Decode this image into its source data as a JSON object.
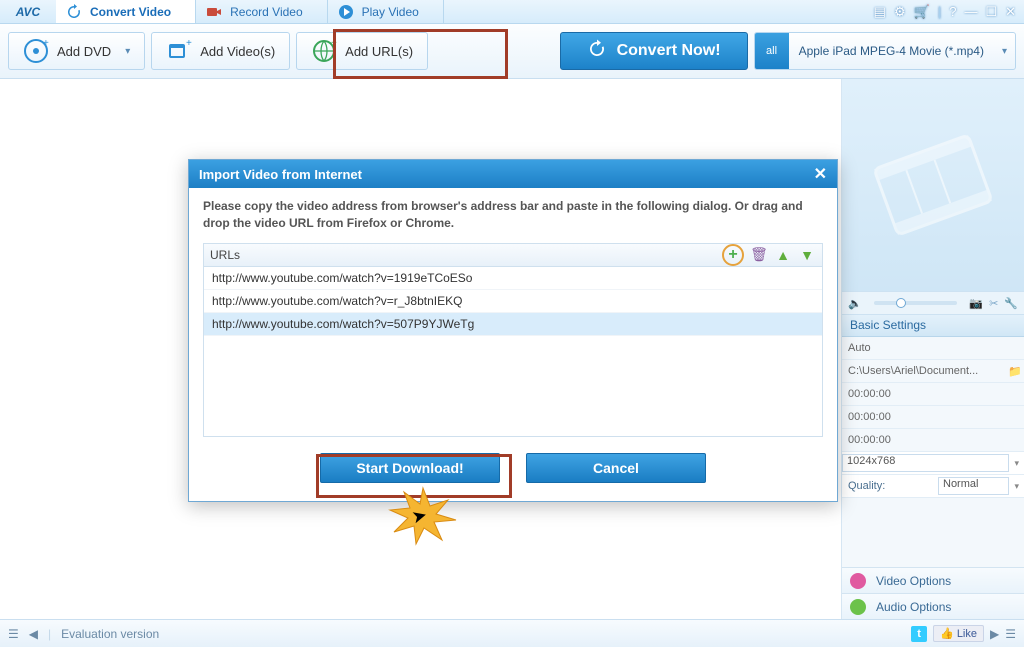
{
  "app": {
    "logo": "AVC"
  },
  "tabs": [
    {
      "label": "Convert Video",
      "active": true
    },
    {
      "label": "Record Video",
      "active": false
    },
    {
      "label": "Play Video",
      "active": false
    }
  ],
  "toolbar": {
    "add_dvd": "Add DVD",
    "add_videos": "Add Video(s)",
    "add_urls": "Add URL(s)",
    "convert_now": "Convert Now!",
    "profile": "Apple iPad MPEG-4 Movie (*.mp4)"
  },
  "dialog": {
    "title": "Import Video from Internet",
    "message": "Please copy the video address from browser's address bar and paste in the following dialog. Or drag and drop the video URL from Firefox or Chrome.",
    "urls_header": "URLs",
    "urls": [
      "http://www.youtube.com/watch?v=1919eTCoESo",
      "http://www.youtube.com/watch?v=r_J8btnIEKQ",
      "http://www.youtube.com/watch?v=507P9YJWeTg"
    ],
    "selected_index": 2,
    "start_btn": "Start Download!",
    "cancel_btn": "Cancel"
  },
  "settings": {
    "header": "Basic Settings",
    "auto": "Auto",
    "path": "C:\\Users\\Ariel\\Document...",
    "t1": "00:00:00",
    "t2": "00:00:00",
    "t3": "00:00:00",
    "size": "1024x768",
    "quality_label": "Quality:",
    "quality_value": "Normal",
    "video_options": "Video Options",
    "audio_options": "Audio Options"
  },
  "statusbar": {
    "text": "Evaluation version",
    "like": "Like"
  }
}
